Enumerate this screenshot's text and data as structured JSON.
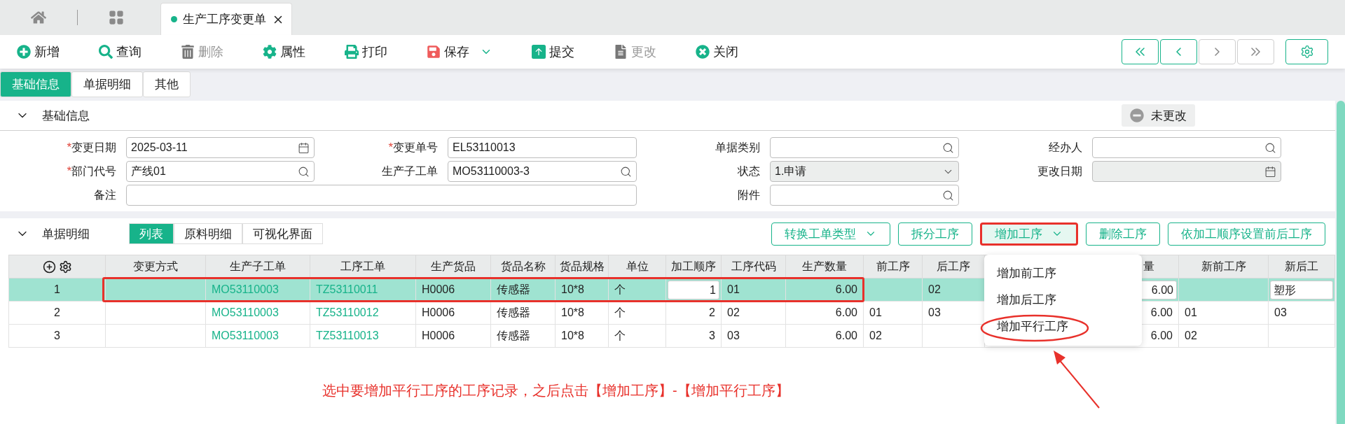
{
  "tab_bar": {
    "open_tab": {
      "title": "生产工序变更单",
      "selected": true
    }
  },
  "toolbar": [
    {
      "kind": "add",
      "label": "新增",
      "disabled": false
    },
    {
      "kind": "search",
      "label": "查询",
      "disabled": false
    },
    {
      "kind": "delete",
      "label": "删除",
      "disabled": true
    },
    {
      "kind": "properties",
      "label": "属性",
      "disabled": false
    },
    {
      "kind": "print",
      "label": "打印",
      "disabled": false
    },
    {
      "kind": "save",
      "label": "保存",
      "disabled": false,
      "has_menu": true
    },
    {
      "kind": "submit",
      "label": "提交",
      "disabled": false
    },
    {
      "kind": "edit",
      "label": "更改",
      "disabled": true
    },
    {
      "kind": "close",
      "label": "关闭",
      "disabled": false
    }
  ],
  "nav_buttons": [
    {
      "kind": "first",
      "disabled": false
    },
    {
      "kind": "prev",
      "disabled": false
    },
    {
      "kind": "next",
      "disabled": true
    },
    {
      "kind": "last",
      "disabled": true
    }
  ],
  "page_tabs": [
    {
      "label": "基础信息",
      "selected": true
    },
    {
      "label": "单据明细",
      "selected": false
    },
    {
      "label": "其他",
      "selected": false
    }
  ],
  "basic_section": {
    "title": "基础信息",
    "expanded": true,
    "status": "未更改",
    "fields": [
      {
        "label": "变更日期",
        "mark": "*",
        "kind": "date",
        "value": "2025-03-11",
        "disabled": false
      },
      {
        "label": "变更单号",
        "mark": "*",
        "kind": "text",
        "value": "EL53110013",
        "disabled": false
      },
      {
        "label": "单据类别",
        "kind": "lookup",
        "disabled": false
      },
      {
        "label": "经办人",
        "kind": "lookup",
        "disabled": false
      },
      {
        "label": "部门代号",
        "mark": "*",
        "kind": "lookup",
        "value": "产线01",
        "disabled": false
      },
      {
        "label": "生产子工单",
        "kind": "lookup",
        "value": "MO53110003-3",
        "disabled": false
      },
      {
        "label": "状态",
        "kind": "select",
        "value": "1.申请",
        "disabled": true
      },
      {
        "label": "更改日期",
        "kind": "date",
        "disabled": true
      },
      {
        "label": "备注",
        "kind": "text",
        "wide": true,
        "disabled": false
      },
      {
        "label": "附件",
        "kind": "lookup",
        "disabled": false
      }
    ]
  },
  "detail_section": {
    "title": "单据明细",
    "expanded": true,
    "view_tabs": [
      {
        "label": "列表",
        "selected": true
      },
      {
        "label": "原料明细",
        "selected": false
      },
      {
        "label": "可视化界面",
        "selected": false
      }
    ],
    "actions": [
      {
        "label": "转换工单类型",
        "has_menu": true,
        "highlighted": false
      },
      {
        "label": "拆分工序",
        "highlighted": false
      },
      {
        "label": "增加工序",
        "has_menu": true,
        "highlighted": true,
        "menu": [
          {
            "label": "增加前工序",
            "circled": false
          },
          {
            "label": "增加后工序",
            "circled": false
          },
          {
            "label": "增加平行工序",
            "circled": true
          }
        ]
      },
      {
        "label": "删除工序",
        "highlighted": false
      },
      {
        "label": "依加工顺序设置前后工序",
        "highlighted": false
      }
    ],
    "table": {
      "columns": [
        {
          "label": "变更方式",
          "kind": "text"
        },
        {
          "label": "生产子工单",
          "kind": "link"
        },
        {
          "label": "工序工单",
          "kind": "link"
        },
        {
          "label": "生产货品",
          "kind": "text"
        },
        {
          "label": "货品名称",
          "kind": "text"
        },
        {
          "label": "货品规格",
          "kind": "text"
        },
        {
          "label": "单位",
          "kind": "text"
        },
        {
          "label": "加工顺序",
          "kind": "edit_number"
        },
        {
          "label": "工序代码",
          "kind": "text"
        },
        {
          "label": "生产数量",
          "kind": "number"
        },
        {
          "label": "前工序",
          "kind": "text"
        },
        {
          "label": "后工序",
          "kind": "text"
        },
        {
          "label": "量",
          "kind": "edit_number"
        },
        {
          "label": "新前工序",
          "kind": "text"
        },
        {
          "label": "新后工",
          "kind": "edit_text"
        }
      ],
      "rows": [
        {
          "no": "1",
          "selected": true,
          "framed": true,
          "cells": [
            null,
            "MO53110003",
            "TZ53110011",
            "H0006",
            "传感器",
            "10*8",
            "个",
            "1",
            "01",
            "6.00",
            null,
            "02",
            "6.00",
            null,
            "塑形"
          ]
        },
        {
          "no": "2",
          "selected": false,
          "framed": false,
          "cells": [
            null,
            "MO53110003",
            "TZ53110012",
            "H0006",
            "传感器",
            "10*8",
            "个",
            "2",
            "02",
            "6.00",
            "01",
            "03",
            "6.00",
            "01",
            "03"
          ]
        },
        {
          "no": "3",
          "selected": false,
          "framed": false,
          "cells": [
            null,
            "MO53110003",
            "TZ53110013",
            "H0006",
            "传感器",
            "10*8",
            "个",
            "3",
            "03",
            "6.00",
            "02",
            null,
            "6.00",
            "02",
            null
          ]
        }
      ]
    },
    "annotation": "选中要增加平行工序的工序记录，之后点击【增加工序】-【增加平行工序】"
  }
}
